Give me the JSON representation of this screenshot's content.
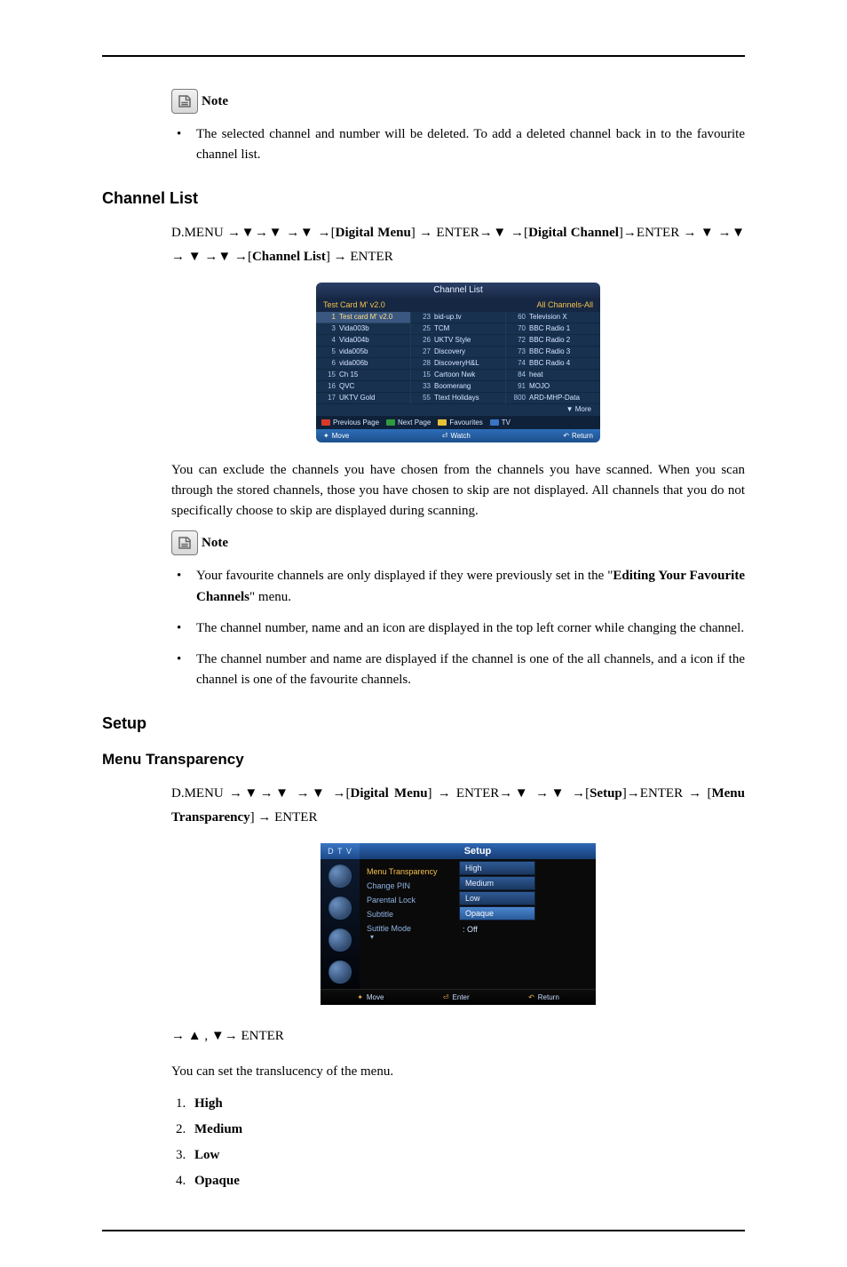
{
  "note_label": "Note",
  "note1": {
    "bullets": [
      "The selected channel and number will be deleted. To add a deleted channel back in to the favourite channel list."
    ]
  },
  "channel_list": {
    "heading": "Channel List",
    "nav_plain_1": "D.MENU →▼→▼ →▼ →[",
    "nav_dm": "Digital Menu",
    "nav_plain_2": "] → ENTER→▼ →[",
    "nav_dc": "Digital Channel",
    "nav_plain_3": "]→ENTER → ▼ →▼ → ▼ →▼ →[",
    "nav_cl": "Channel List",
    "nav_plain_4": "] → ENTER",
    "screenshot": {
      "title": "Channel List",
      "header_left": "Test Card M' v2.0",
      "header_right": "All Channels-All",
      "col1": [
        {
          "n": "1",
          "t": "Test card M' v2.0",
          "sel": true
        },
        {
          "n": "3",
          "t": "Vida003b"
        },
        {
          "n": "4",
          "t": "Vida004b"
        },
        {
          "n": "5",
          "t": "vida005b"
        },
        {
          "n": "6",
          "t": "vida006b"
        },
        {
          "n": "15",
          "t": "Ch 15"
        },
        {
          "n": "16",
          "t": "QVC"
        },
        {
          "n": "17",
          "t": "UKTV Gold"
        }
      ],
      "col2": [
        {
          "n": "23",
          "t": "bid-up.tv"
        },
        {
          "n": "25",
          "t": "TCM"
        },
        {
          "n": "26",
          "t": "UKTV Style"
        },
        {
          "n": "27",
          "t": "Discovery"
        },
        {
          "n": "28",
          "t": "DiscoveryH&L"
        },
        {
          "n": "15",
          "t": "Cartoon Nwk"
        },
        {
          "n": "33",
          "t": "Boomerang"
        },
        {
          "n": "55",
          "t": "Ttext Holidays"
        }
      ],
      "col3": [
        {
          "n": "60",
          "t": "Television X"
        },
        {
          "n": "70",
          "t": "BBC Radio 1"
        },
        {
          "n": "72",
          "t": "BBC Radio 2"
        },
        {
          "n": "73",
          "t": "BBC Radio 3"
        },
        {
          "n": "74",
          "t": "BBC Radio 4"
        },
        {
          "n": "84",
          "t": "heat"
        },
        {
          "n": "91",
          "t": "MOJO"
        },
        {
          "n": "800",
          "t": "ARD-MHP-Data"
        }
      ],
      "more": "▼ More",
      "legend": {
        "prev": {
          "color": "#d83a2a",
          "label": "Previous Page"
        },
        "next": {
          "color": "#2e9b3e",
          "label": "Next Page"
        },
        "fav": {
          "color": "#e6c23a",
          "label": "Favourites"
        },
        "tv": {
          "color": "#3a74c5",
          "label": "TV"
        }
      },
      "hints": {
        "move": "Move",
        "watch": "Watch",
        "return": "Return"
      }
    },
    "body_para": "You can exclude the channels you have chosen from the channels you have scanned. When you scan through the stored channels, those you have chosen to skip are not displayed. All channels that you do not specifically choose to skip are displayed during scanning.",
    "bullets": [
      {
        "pre": "Your favourite channels are only displayed if they were previously set in the \"",
        "b": "Editing Your Favourite Channels",
        "post": "\" menu."
      },
      {
        "pre": "The channel number, name and an icon are displayed in the top left corner while changing the channel.",
        "b": "",
        "post": ""
      },
      {
        "pre": "The channel number and name are displayed if the channel is one of the all channels, and a icon if the channel is one of the favourite channels.",
        "b": "",
        "post": ""
      }
    ]
  },
  "setup": {
    "heading": "Setup",
    "sub_heading": "Menu Transparency",
    "nav_plain_1": "D.MENU →▼→▼ →▼ →[",
    "nav_dm": "Digital Menu",
    "nav_plain_2": "] → ENTER→▼ →▼ →[",
    "nav_setup": "Setup",
    "nav_plain_3": "]→ENTER → [",
    "nav_mt": "Menu Transparency",
    "nav_plain_4": "] → ENTER",
    "screenshot": {
      "tab": "D T V",
      "title": "Setup",
      "menu": [
        "Menu Transparency",
        "Change PIN",
        "Parental Lock",
        "Subtitle",
        "Sutitle Mode"
      ],
      "options": [
        "High",
        "Medium",
        "Low",
        "Opaque"
      ],
      "selected_option_index": 3,
      "subtitle_value": ": Off",
      "hints": {
        "move": "Move",
        "enter": "Enter",
        "return": "Return"
      }
    },
    "post_nav": "→ ▲ , ▼→ ENTER",
    "body_para": "You can set the translucency of the menu.",
    "list": [
      "High",
      "Medium",
      "Low",
      "Opaque"
    ]
  }
}
